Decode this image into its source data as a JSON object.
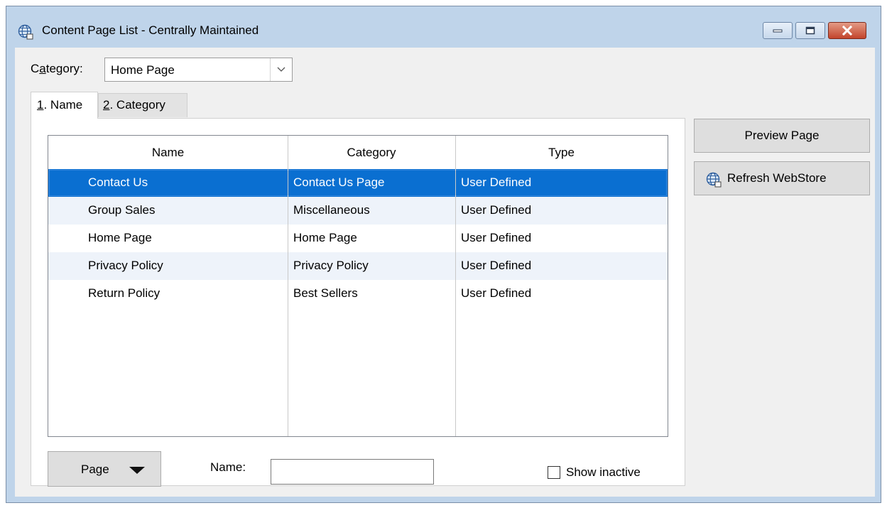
{
  "window": {
    "title": "Content Page List - Centrally Maintained",
    "icon": "globe-icon",
    "controls": [
      "minimize-icon",
      "maximize-icon",
      "close-icon"
    ]
  },
  "category": {
    "label_prefix": "C",
    "label_underlined": "a",
    "label_rest": "tegory:",
    "selected": "Home Page"
  },
  "tabs": [
    {
      "index_underlined": "1",
      "label": ". Name",
      "active": true
    },
    {
      "index_underlined": "2",
      "label": ". Category",
      "active": false
    }
  ],
  "table": {
    "columns": [
      "Name",
      "Category",
      "Type"
    ],
    "rows": [
      {
        "name": "Contact Us",
        "category": "Contact Us Page",
        "type": "User Defined",
        "selected": true
      },
      {
        "name": "Group Sales",
        "category": "Miscellaneous",
        "type": "User Defined",
        "selected": false
      },
      {
        "name": "Home Page",
        "category": "Home Page",
        "type": "User Defined",
        "selected": false
      },
      {
        "name": "Privacy Policy",
        "category": "Privacy Policy",
        "type": "User Defined",
        "selected": false
      },
      {
        "name": "Return Policy",
        "category": "Best Sellers",
        "type": "User Defined",
        "selected": false
      }
    ]
  },
  "footer": {
    "page_button": "Page",
    "name_label": "Name:",
    "name_value": "",
    "show_inactive_label": "Show inactive",
    "show_inactive_checked": false
  },
  "side_buttons": {
    "preview": "Preview Page",
    "refresh": "Refresh WebStore"
  },
  "colors": {
    "selection": "#0a6fd1",
    "alt_row": "#eef3fa",
    "frame": "#bfd4ea",
    "close_button": "#c3442b"
  }
}
